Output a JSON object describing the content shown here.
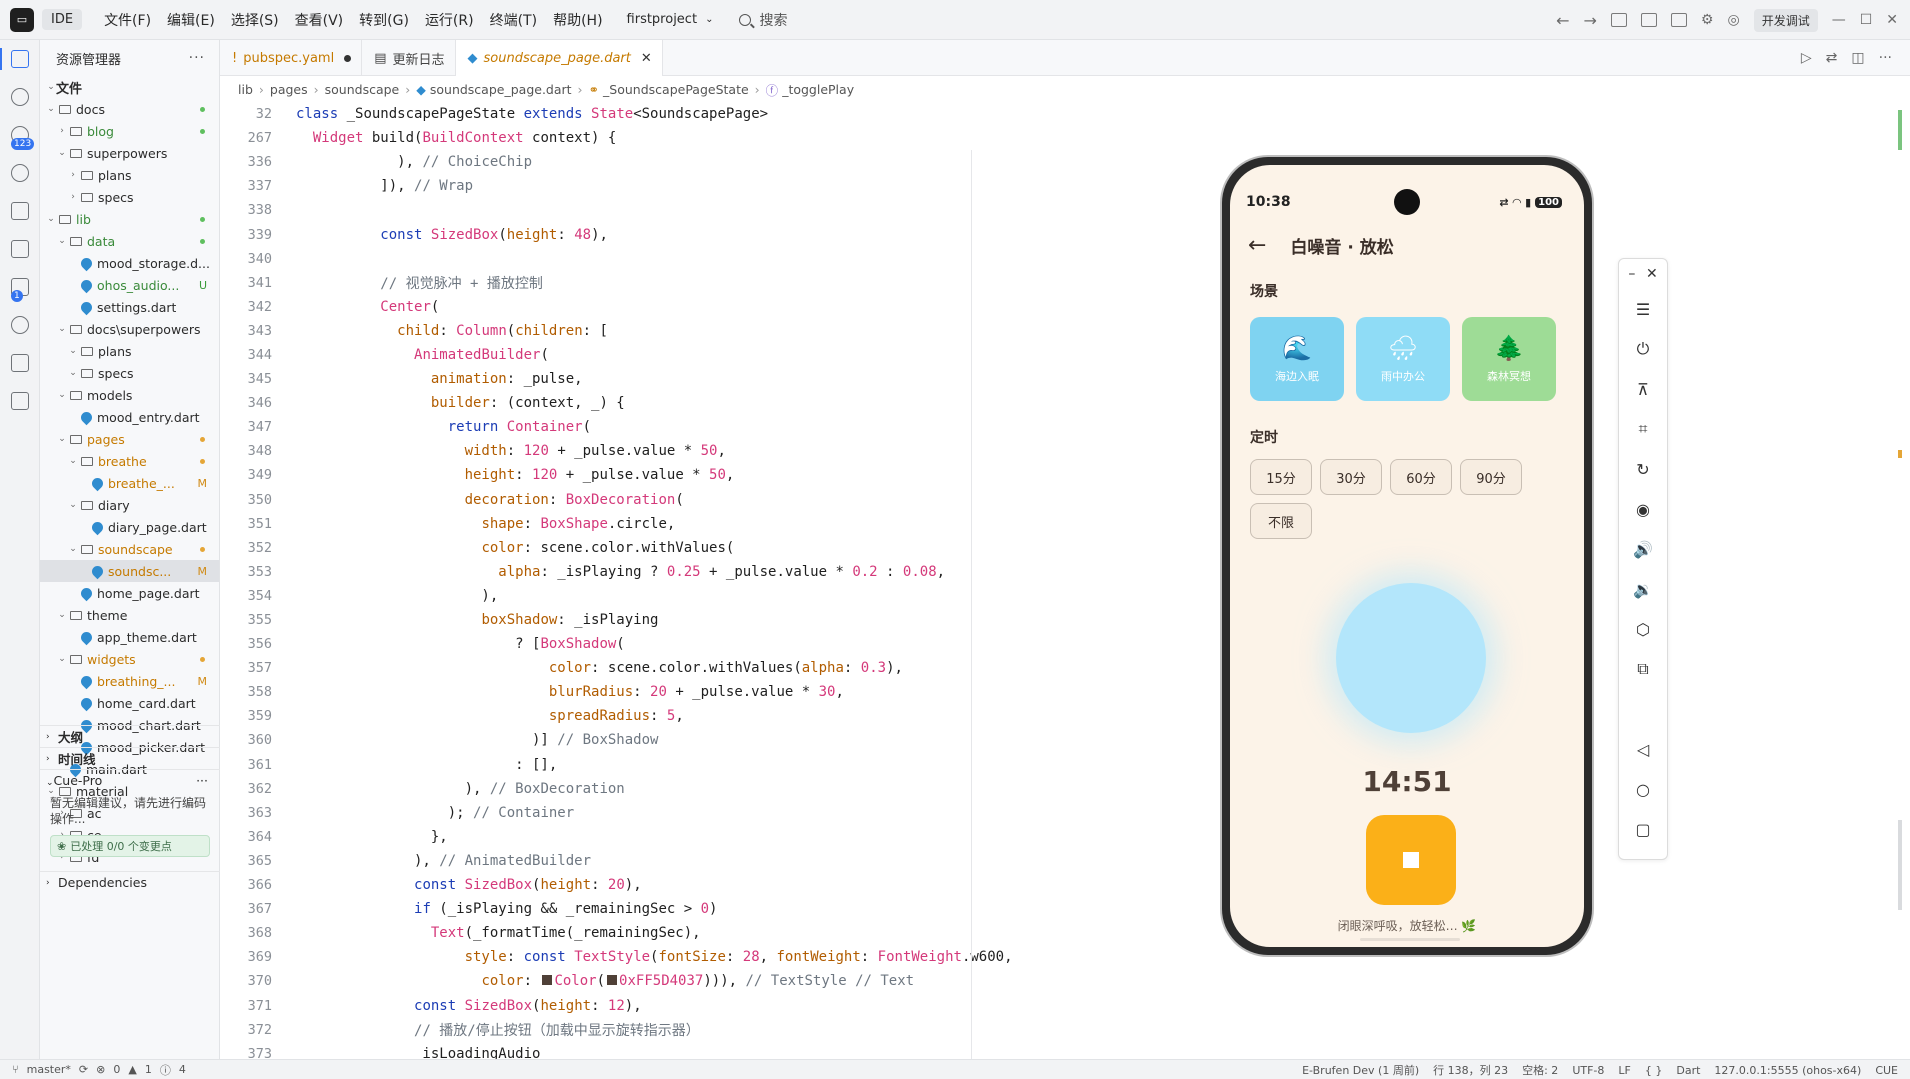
{
  "titlebar": {
    "logo": "IDE",
    "ide_label": "IDE",
    "menu": [
      "文件(F)",
      "编辑(E)",
      "选择(S)",
      "查看(V)",
      "转到(G)",
      "运行(R)",
      "终端(T)",
      "帮助(H)"
    ],
    "project": "firstproject",
    "search": "搜索",
    "status_pill": "开发调试"
  },
  "explorer": {
    "title": "资源管理器",
    "more": "···",
    "root": "文件",
    "tree": [
      {
        "indent": 0,
        "type": "folder",
        "open": true,
        "label": "docs",
        "mark": "dot-g"
      },
      {
        "indent": 1,
        "type": "folder",
        "open": false,
        "label": "blog",
        "mark": "dot-g",
        "untracked": true
      },
      {
        "indent": 1,
        "type": "folder",
        "open": true,
        "label": "superpowers",
        "mark": ""
      },
      {
        "indent": 2,
        "type": "folder",
        "open": false,
        "label": "plans",
        "mark": ""
      },
      {
        "indent": 2,
        "type": "folder",
        "open": false,
        "label": "specs",
        "mark": ""
      },
      {
        "indent": 0,
        "type": "folder",
        "open": true,
        "label": "lib",
        "mark": "dot-g",
        "untracked": true
      },
      {
        "indent": 1,
        "type": "folder",
        "open": true,
        "label": "data",
        "mark": "dot-g",
        "untracked": true
      },
      {
        "indent": 2,
        "type": "dart",
        "label": "mood_storage.d...",
        "mark": ""
      },
      {
        "indent": 2,
        "type": "dart",
        "label": "ohos_audio...",
        "mark": "U",
        "untracked": true
      },
      {
        "indent": 2,
        "type": "dart",
        "label": "settings.dart",
        "mark": ""
      },
      {
        "indent": 1,
        "type": "folder",
        "open": true,
        "label": "docs\\superpowers",
        "mark": ""
      },
      {
        "indent": 2,
        "type": "folder",
        "open": true,
        "label": "plans",
        "mark": ""
      },
      {
        "indent": 2,
        "type": "folder",
        "open": true,
        "label": "specs",
        "mark": ""
      },
      {
        "indent": 1,
        "type": "folder",
        "open": true,
        "label": "models",
        "mark": ""
      },
      {
        "indent": 2,
        "type": "dart",
        "label": "mood_entry.dart",
        "mark": ""
      },
      {
        "indent": 1,
        "type": "folder",
        "open": true,
        "label": "pages",
        "mark": "dot-o",
        "modified": true
      },
      {
        "indent": 2,
        "type": "folder",
        "open": true,
        "label": "breathe",
        "mark": "dot-o",
        "modified": true
      },
      {
        "indent": 3,
        "type": "dart",
        "label": "breathe_...",
        "mark": "M",
        "modified": true
      },
      {
        "indent": 2,
        "type": "folder",
        "open": true,
        "label": "diary",
        "mark": ""
      },
      {
        "indent": 3,
        "type": "dart",
        "label": "diary_page.dart",
        "mark": ""
      },
      {
        "indent": 2,
        "type": "folder",
        "open": true,
        "label": "soundscape",
        "mark": "dot-o",
        "modified": true
      },
      {
        "indent": 3,
        "type": "dart",
        "label": "soundsc...",
        "mark": "M",
        "modified": true,
        "selected": true
      },
      {
        "indent": 2,
        "type": "dart",
        "label": "home_page.dart",
        "mark": ""
      },
      {
        "indent": 1,
        "type": "folder",
        "open": true,
        "label": "theme",
        "mark": ""
      },
      {
        "indent": 2,
        "type": "dart",
        "label": "app_theme.dart",
        "mark": ""
      },
      {
        "indent": 1,
        "type": "folder",
        "open": true,
        "label": "widgets",
        "mark": "dot-o",
        "modified": true
      },
      {
        "indent": 2,
        "type": "dart",
        "label": "breathing_...",
        "mark": "M",
        "modified": true
      },
      {
        "indent": 2,
        "type": "dart",
        "label": "home_card.dart",
        "mark": ""
      },
      {
        "indent": 2,
        "type": "dart",
        "label": "mood_chart.dart",
        "mark": ""
      },
      {
        "indent": 2,
        "type": "dart",
        "label": "mood_picker.dart",
        "mark": ""
      },
      {
        "indent": 1,
        "type": "dart",
        "label": "main.dart",
        "mark": ""
      },
      {
        "indent": 0,
        "type": "folder",
        "open": true,
        "label": "material",
        "mark": ""
      },
      {
        "indent": 1,
        "type": "folder",
        "open": false,
        "label": "ac",
        "mark": ""
      },
      {
        "indent": 1,
        "type": "folder",
        "open": false,
        "label": "ce",
        "mark": ""
      },
      {
        "indent": 1,
        "type": "folder",
        "open": false,
        "label": "fd",
        "mark": ""
      }
    ],
    "sections": [
      "大纲",
      "时间线"
    ],
    "cue_title": "Cue-Pro",
    "cue_text": "暂无编辑建议，请先进行编码操作...",
    "cue_badge": "已处理 0/0 个变更点",
    "dependencies": "Dependencies"
  },
  "tabs": [
    {
      "label": "pubspec.yaml",
      "indicator": "!",
      "state": "dirty"
    },
    {
      "label": "更新日志",
      "indicator": "▤",
      "state": ""
    },
    {
      "label": "soundscape_page.dart",
      "indicator": "◆",
      "state": "active"
    }
  ],
  "breadcrumb": [
    "lib",
    "pages",
    "soundscape",
    "soundscape_page.dart",
    "_SoundscapePageState",
    "_togglePlay"
  ],
  "code": [
    {
      "n": "32",
      "t": "class _SoundscapePageState extends State<SoundscapePage>"
    },
    {
      "n": "267",
      "t": "  Widget build(BuildContext context) {"
    },
    {
      "n": "336",
      "t": "            ), // ChoiceChip"
    },
    {
      "n": "337",
      "t": "          ]), // Wrap"
    },
    {
      "n": "338",
      "t": ""
    },
    {
      "n": "339",
      "t": "          const SizedBox(height: 48),"
    },
    {
      "n": "340",
      "t": ""
    },
    {
      "n": "341",
      "t": "          // 视觉脉冲 + 播放控制"
    },
    {
      "n": "342",
      "t": "          Center("
    },
    {
      "n": "343",
      "t": "            child: Column(children: ["
    },
    {
      "n": "344",
      "t": "              AnimatedBuilder("
    },
    {
      "n": "345",
      "t": "                animation: _pulse,"
    },
    {
      "n": "346",
      "t": "                builder: (context, _) {"
    },
    {
      "n": "347",
      "t": "                  return Container("
    },
    {
      "n": "348",
      "t": "                    width: 120 + _pulse.value * 50,"
    },
    {
      "n": "349",
      "t": "                    height: 120 + _pulse.value * 50,"
    },
    {
      "n": "350",
      "t": "                    decoration: BoxDecoration("
    },
    {
      "n": "351",
      "t": "                      shape: BoxShape.circle,"
    },
    {
      "n": "352",
      "t": "                      color: scene.color.withValues("
    },
    {
      "n": "353",
      "t": "                        alpha: _isPlaying ? 0.25 + _pulse.value * 0.2 : 0.08,"
    },
    {
      "n": "354",
      "t": "                      ),"
    },
    {
      "n": "355",
      "t": "                      boxShadow: _isPlaying"
    },
    {
      "n": "356",
      "t": "                          ? [BoxShadow("
    },
    {
      "n": "357",
      "t": "                              color: scene.color.withValues(alpha: 0.3),"
    },
    {
      "n": "358",
      "t": "                              blurRadius: 20 + _pulse.value * 30,"
    },
    {
      "n": "359",
      "t": "                              spreadRadius: 5,"
    },
    {
      "n": "360",
      "t": "                            )] // BoxShadow"
    },
    {
      "n": "361",
      "t": "                          : [],"
    },
    {
      "n": "362",
      "t": "                    ), // BoxDecoration"
    },
    {
      "n": "363",
      "t": "                  ); // Container"
    },
    {
      "n": "364",
      "t": "                },"
    },
    {
      "n": "365",
      "t": "              ), // AnimatedBuilder"
    },
    {
      "n": "366",
      "t": "              const SizedBox(height: 20),"
    },
    {
      "n": "367",
      "t": "              if (_isPlaying && _remainingSec > 0)"
    },
    {
      "n": "368",
      "t": "                Text(_formatTime(_remainingSec),"
    },
    {
      "n": "369",
      "t": "                    style: const TextStyle(fontSize: 28, fontWeight: FontWeight.w600,"
    },
    {
      "n": "370",
      "t": "                      color: ■Color(■0xFF5D4037))), // TextStyle // Text"
    },
    {
      "n": "371",
      "t": "              const SizedBox(height: 12),"
    },
    {
      "n": "372",
      "t": "              // 播放/停止按钮（加载中显示旋转指示器）"
    },
    {
      "n": "373",
      "t": "              _isLoadingAudio"
    }
  ],
  "phone": {
    "time": "10:38",
    "battery": "100",
    "title": "白噪音 · 放松",
    "scene_section": "场景",
    "scenes": [
      {
        "label": "海边入眠",
        "icon": "🌊",
        "color": "#7fd3f1"
      },
      {
        "label": "雨中办公",
        "icon": "🌧",
        "color": "#8fdcf6"
      },
      {
        "label": "森林冥想",
        "icon": "🌲",
        "color": "#9edc96"
      }
    ],
    "timer_section": "定时",
    "timers": [
      "15分",
      "30分",
      "60分",
      "90分",
      "不限"
    ],
    "remaining": "14:51",
    "hint": "闭眼深呼吸，放轻松… 🌿"
  },
  "statusbar": {
    "branch": "master*",
    "errors": "0",
    "warnings": "1",
    "infos": "4",
    "device": "E-Brufen Dev (1 周前)",
    "position": "行 138，列 23",
    "spaces": "空格: 2",
    "encoding": "UTF-8",
    "eol": "LF",
    "braces": "{ }",
    "language": "Dart",
    "address": "127.0.0.1:5555 (ohos-x64)",
    "cue": "CUE"
  },
  "colors": {
    "accent": "#3574f0",
    "play_button": "#fbb018",
    "pulse": "#b3e6fb"
  }
}
